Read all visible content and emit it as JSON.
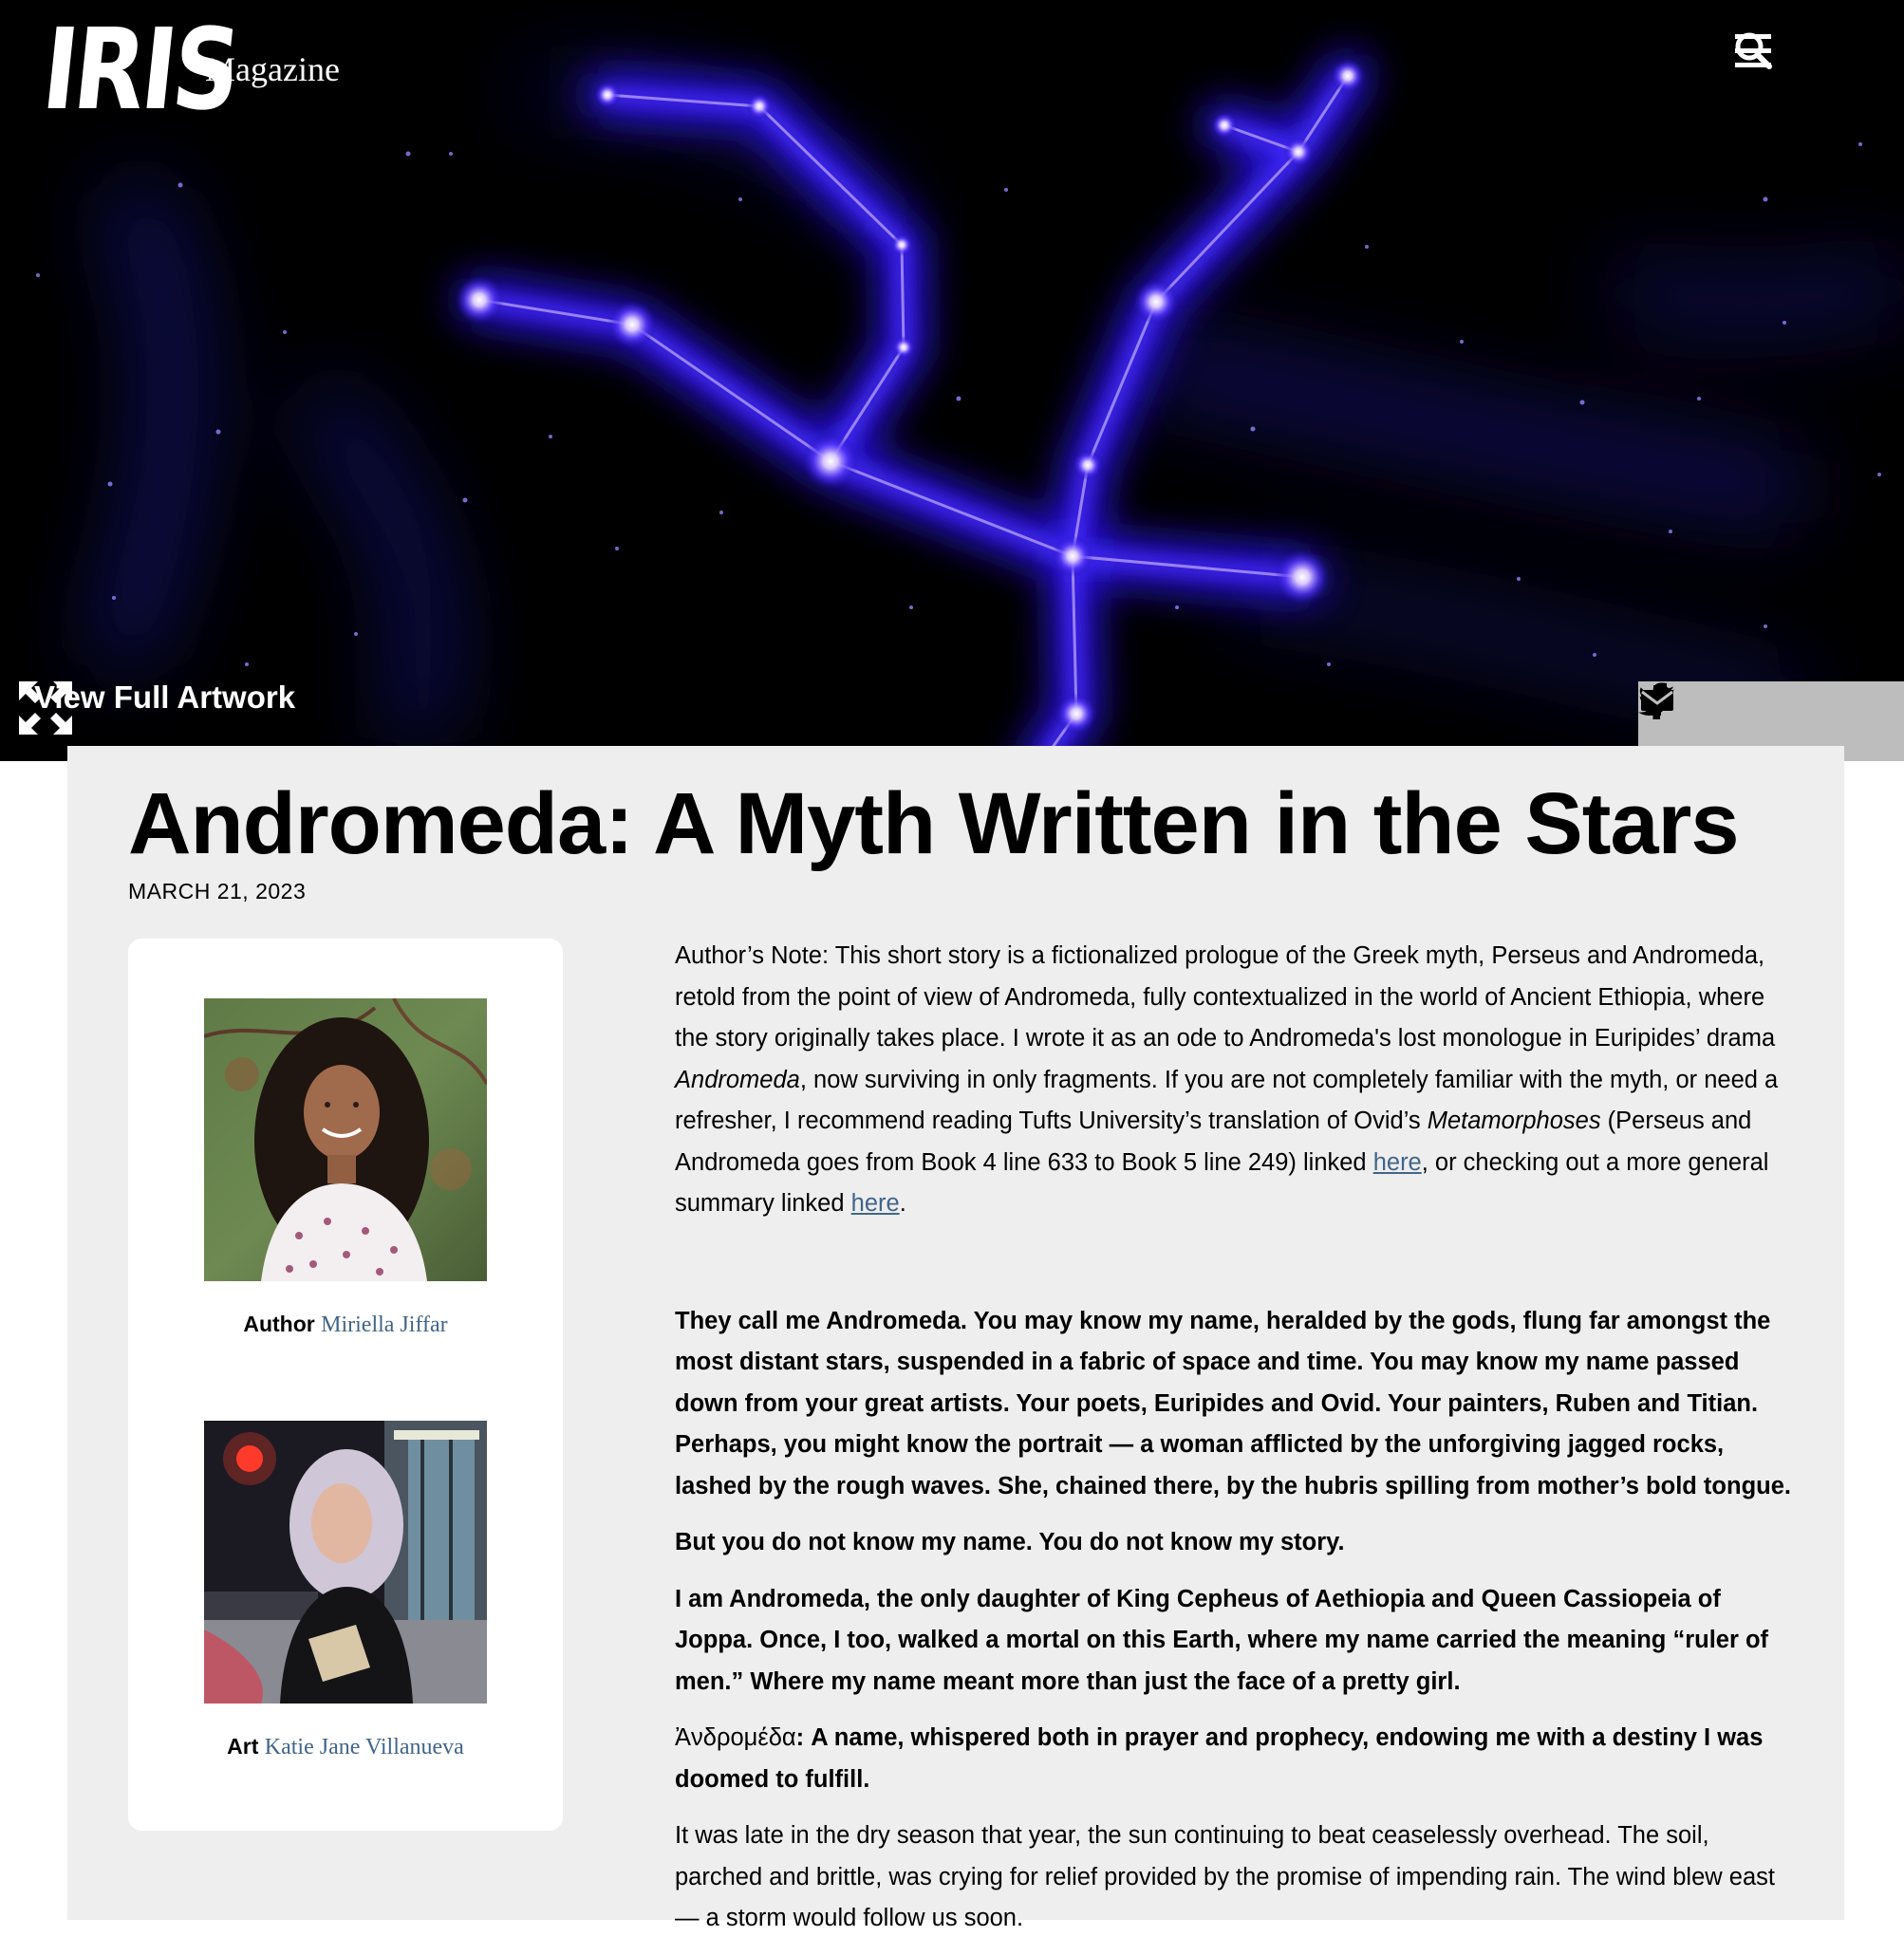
{
  "brand": {
    "logo": "IRIS",
    "magazine": "Magazine"
  },
  "header": {
    "icons": [
      "menu-icon",
      "search-icon"
    ]
  },
  "hero": {
    "view_full_label": "View Full Artwork",
    "share_icons": [
      "plus-icon",
      "facebook-icon",
      "twitter-icon",
      "email-icon"
    ]
  },
  "article": {
    "title": "Andromeda: A Myth Written in the Stars",
    "date": "MARCH 21, 2023",
    "credits": [
      {
        "role": "Author",
        "name": "Miriella Jiffar"
      },
      {
        "role": "Art",
        "name": "Katie Jane Villanueva"
      }
    ],
    "note": {
      "part1": "Author’s Note: This short story is a fictionalized prologue of the Greek myth, Perseus and Andromeda, retold from the point of view of Andromeda, fully contextualized in the world of Ancient Ethiopia, where the story originally takes place. I wrote it as an ode to Andromeda's lost monologue in Euripides’ drama ",
      "italic1": "Andromeda",
      "part2": ", now surviving in only fragments. If you are not completely familiar with the myth, or need a refresher, I recommend reading Tufts University’s translation of Ovid’s ",
      "italic2": "Metamorphoses",
      "part3": " (Perseus and Andromeda goes from Book 4 line 633 to Book 5 line 249) linked ",
      "link1": "here",
      "part4": ", or checking out a more general summary linked ",
      "link2": "here",
      "part5": "."
    },
    "paragraphs": {
      "p1": "They call me Andromeda. You may know my name, heralded by the gods, flung far amongst the most distant stars, suspended in a fabric of space and time. You may know my name passed down from your great artists. Your poets, Euripides and Ovid. Your painters, Ruben and Titian. Perhaps, you might know the portrait — a woman afflicted by the unforgiving jagged rocks, lashed by the rough waves. She, chained there, by the hubris spilling from mother’s bold tongue.",
      "p2": "But you do not know my name. You do not know my story.",
      "p3": "I am Andromeda, the only daughter of King Cepheus of Aethiopia and Queen Cassiopeia of Joppa. Once, I too, walked a mortal on this Earth, where my name carried the meaning “ruler of men.” Where my name meant more than just the face of a pretty girl.",
      "p4_greek": "Ἀνδρομέδα",
      "p4_rest": ": A name, whispered both in prayer and prophecy, endowing me with a destiny I was doomed to fulfill.",
      "p5": "It was late in the dry season that year, the sun continuing to beat ceaselessly overhead. The soil, parched and brittle, was crying for relief provided by the promise of impending rain. The wind blew east — a storm would follow us soon."
    }
  },
  "colors": {
    "link": "#41658a",
    "panel": "#eeeeee",
    "share_bar": "#bdbdbd",
    "glow": "#3b1cff"
  }
}
